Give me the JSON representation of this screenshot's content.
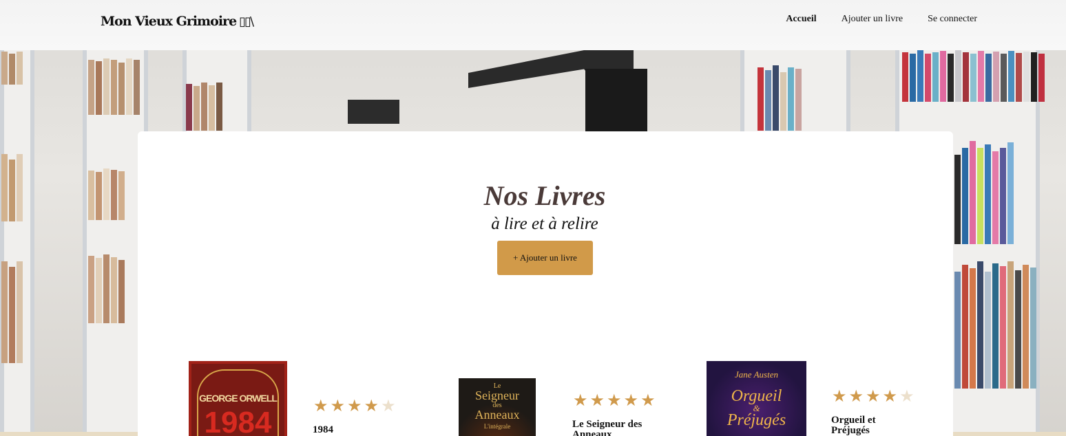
{
  "navbar": {
    "logo_text": "Mon Vieux Grimoire",
    "logo_icon": "books-icon",
    "links": [
      {
        "label": "Accueil",
        "active": true
      },
      {
        "label": "Ajouter un livre",
        "active": false
      },
      {
        "label": "Se connecter",
        "active": false
      }
    ]
  },
  "hero": {
    "title": "Nos Livres",
    "subtitle": "à lire et à relire",
    "add_button": "+ Ajouter un livre"
  },
  "books": [
    {
      "title": "1984",
      "rating": 4,
      "max_rating": 5,
      "cover": {
        "author": "GEORGE ORWELL",
        "text": "1984"
      }
    },
    {
      "title": "Le Seigneur des Anneaux",
      "rating": 5,
      "max_rating": 5,
      "cover": {
        "small": "Le",
        "line1": "Seigneur",
        "small2": "des",
        "line2": "Anneaux",
        "sub": "L'intégrale"
      }
    },
    {
      "title": "Orgueil et Préjugés",
      "rating": 4,
      "max_rating": 5,
      "cover": {
        "author": "Jane Austen",
        "line1": "Orgueil",
        "small": "&",
        "line2": "Préjugés"
      }
    }
  ],
  "colors": {
    "accent": "#d19a49",
    "star_full": "#d09a4c",
    "star_empty": "#ece0cc",
    "title_text": "#4a3a38"
  }
}
